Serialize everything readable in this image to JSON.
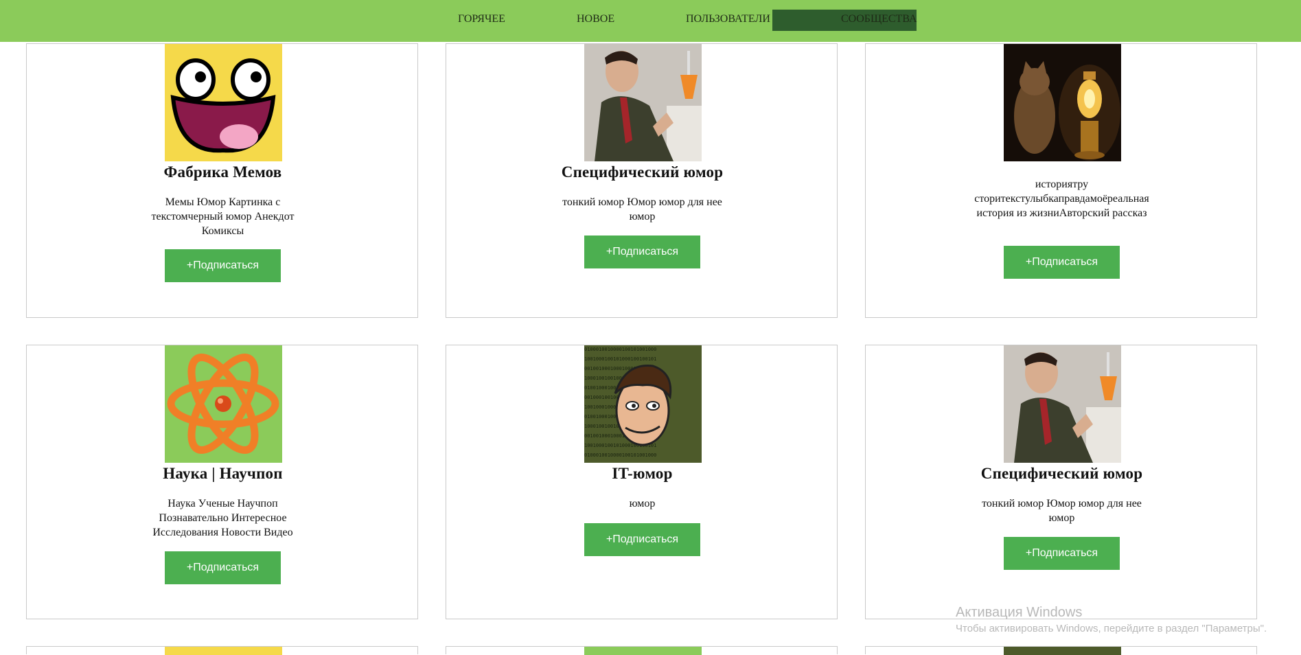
{
  "nav": {
    "items": [
      {
        "label": "ГОРЯЧЕЕ"
      },
      {
        "label": "НОВОЕ"
      },
      {
        "label": "ПОЛЬЗОВАТЕЛИ"
      },
      {
        "label": "СООБЩЕСТВА",
        "active": true
      }
    ]
  },
  "cards": [
    {
      "title": "Фабрика Мемов",
      "desc": "Мемы Юмор Картинка с текстомчерный юмор Анекдот Комиксы",
      "button": "+Подписаться",
      "avatar": "awesome-face-icon"
    },
    {
      "title": "Специфический юмор",
      "desc": "тонкий юмор Юмор юмор для нее юмор",
      "button": "+Подписаться",
      "avatar": "man-with-cocktail-photo"
    },
    {
      "title": "",
      "desc": "историятру сторитекстулыбкаправдамоёреальная история из жизниАвторский рассказ",
      "button": "+Подписаться",
      "avatar": "cat-with-lamp-photo"
    },
    {
      "title": "Наука | Научпоп",
      "desc": "Наука Ученые Научпоп Познавательно Интересное Исследования Новости Видео",
      "button": "+Подписаться",
      "avatar": "atom-icon"
    },
    {
      "title": "IT-юмор",
      "desc": "юмор",
      "button": "+Подписаться",
      "avatar": "it-face-binary-icon"
    },
    {
      "title": "Специфический юмор",
      "desc": "тонкий юмор Юмор юмор для нее юмор",
      "button": "+Подписаться",
      "avatar": "man-with-cocktail-photo"
    }
  ],
  "watermark": {
    "line1": "Активация Windows",
    "line2": "Чтобы активировать Windows, перейдите в раздел \"Параметры\"."
  },
  "colors": {
    "topbar": "#8bcb5a",
    "nav_active": "#2e5d2d",
    "button": "#4caf50"
  }
}
